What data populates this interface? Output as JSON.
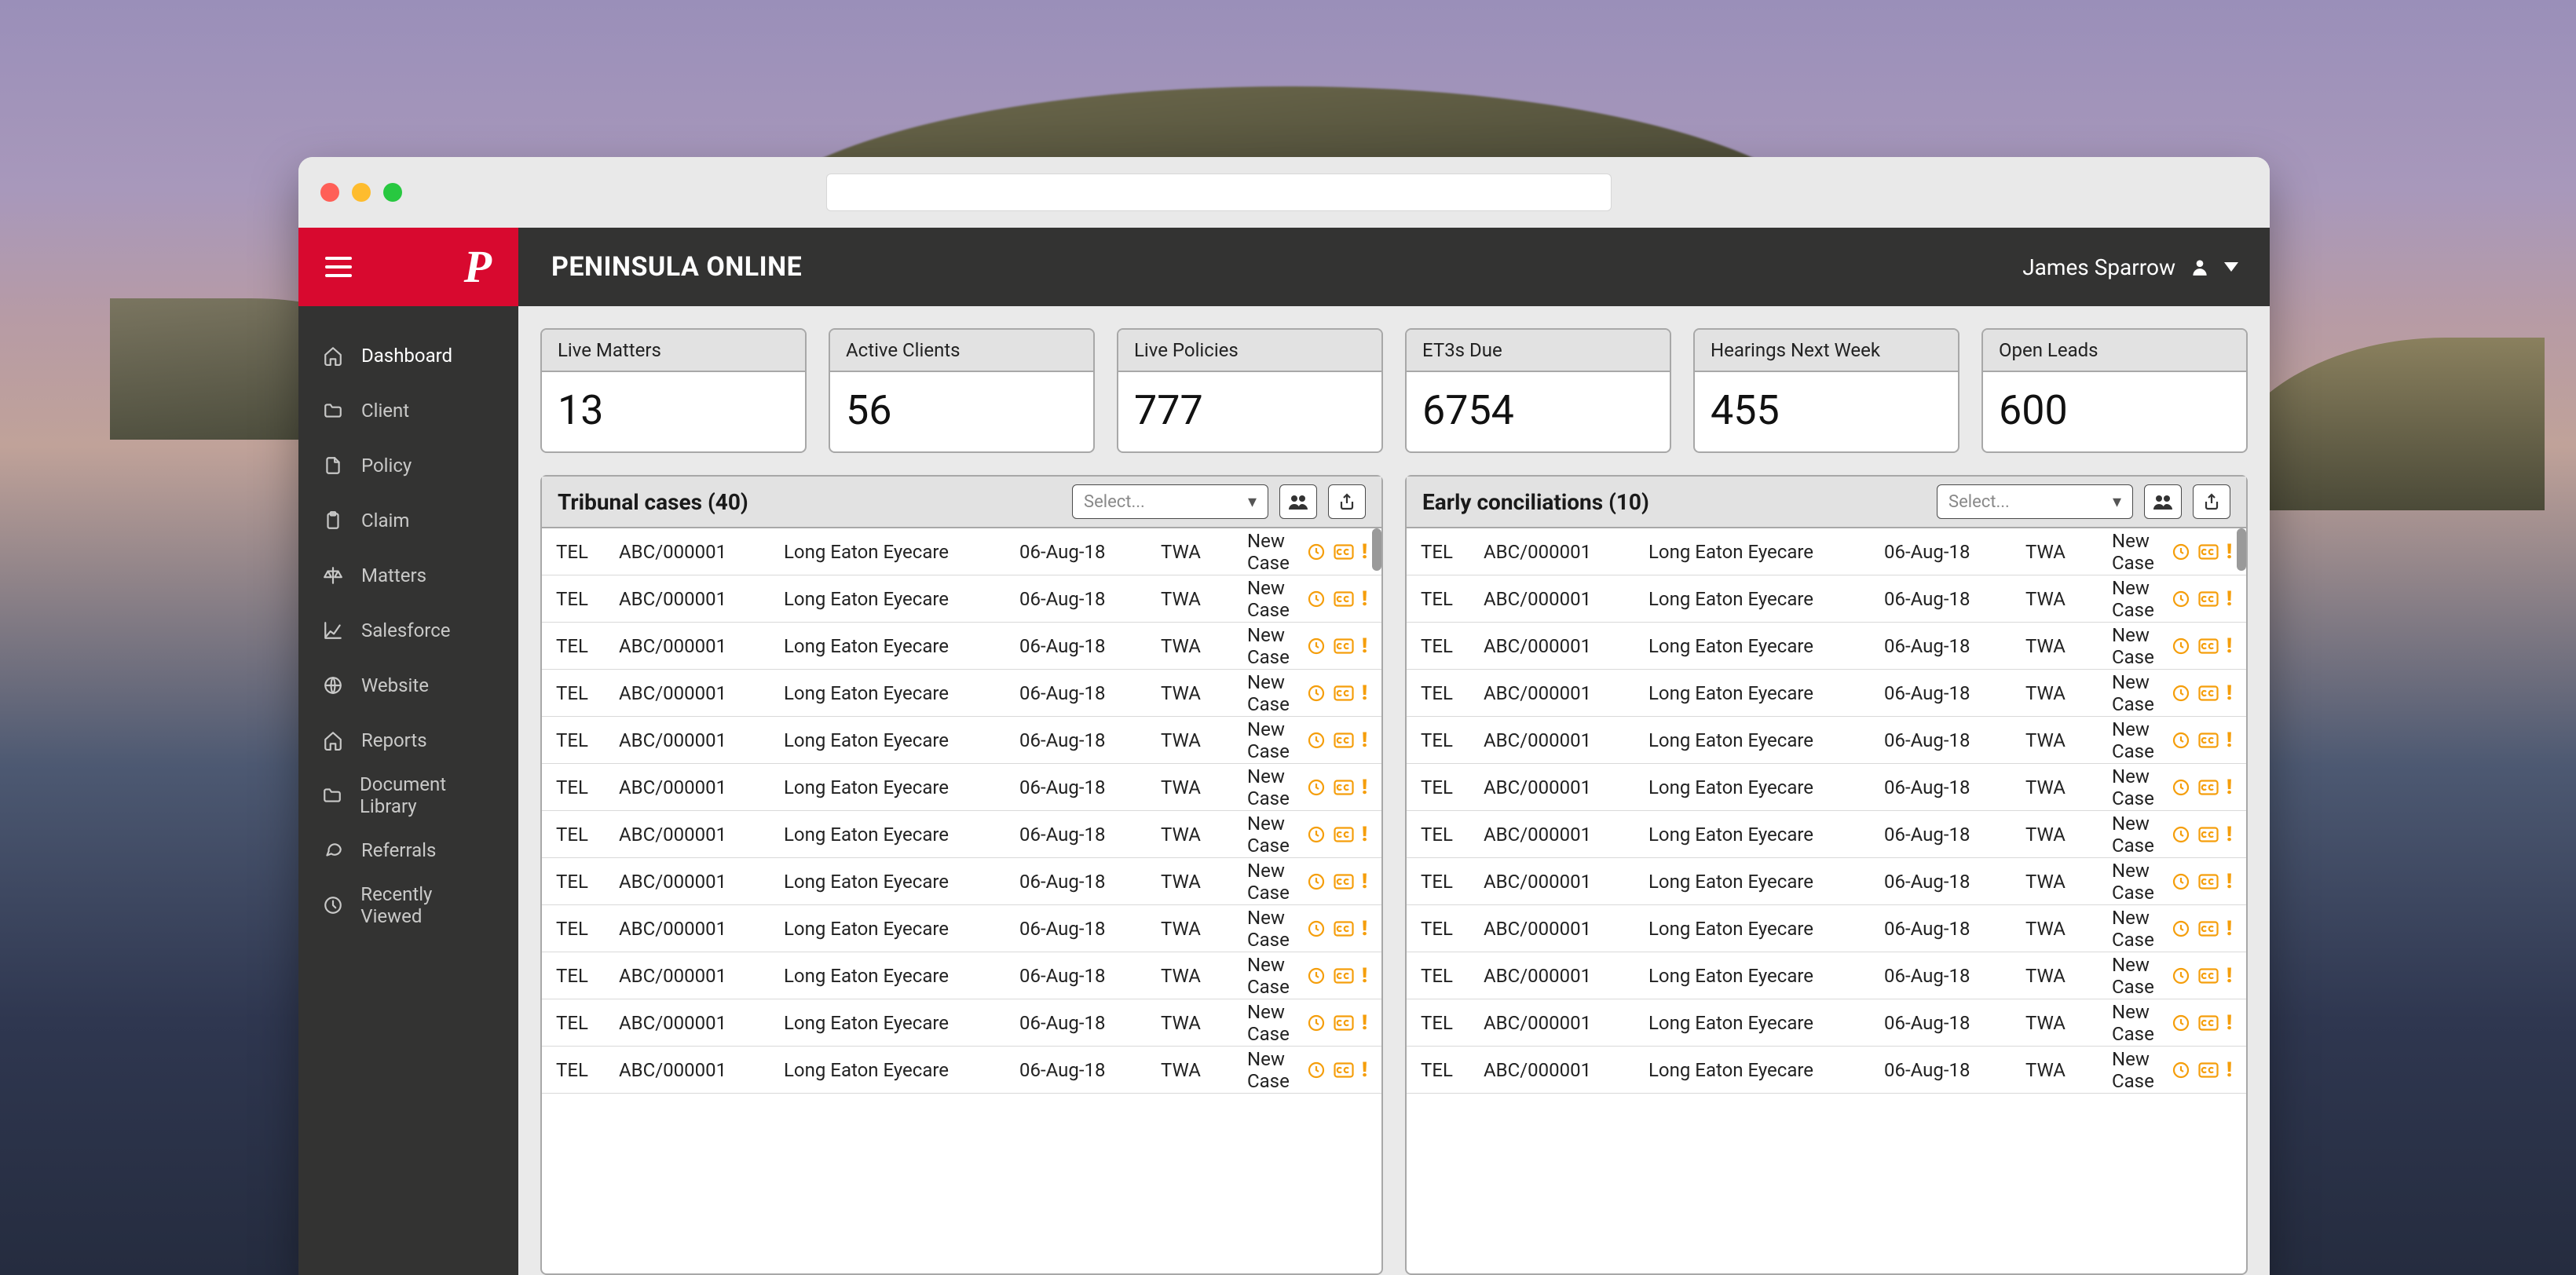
{
  "header": {
    "app_title": "PENINSULA ONLINE",
    "user_name": "James Sparrow"
  },
  "sidebar": {
    "items": [
      {
        "label": "Dashboard",
        "icon": "home"
      },
      {
        "label": "Client",
        "icon": "folder"
      },
      {
        "label": "Policy",
        "icon": "file"
      },
      {
        "label": "Claim",
        "icon": "clipboard"
      },
      {
        "label": "Matters",
        "icon": "scale"
      },
      {
        "label": "Salesforce",
        "icon": "chart"
      },
      {
        "label": "Website",
        "icon": "globe"
      },
      {
        "label": "Reports",
        "icon": "home"
      },
      {
        "label": "Document Library",
        "icon": "folder"
      },
      {
        "label": "Referrals",
        "icon": "chat"
      },
      {
        "label": "Recently Viewed",
        "icon": "clock"
      }
    ]
  },
  "stats": [
    {
      "label": "Live Matters",
      "value": "13"
    },
    {
      "label": "Active Clients",
      "value": "56"
    },
    {
      "label": "Live Policies",
      "value": "777"
    },
    {
      "label": "ET3s Due",
      "value": "6754"
    },
    {
      "label": "Hearings Next Week",
      "value": "455"
    },
    {
      "label": "Open Leads",
      "value": "600"
    }
  ],
  "panels": [
    {
      "title": "Tribunal cases (40)",
      "select_placeholder": "Select...",
      "rows": [
        {
          "type": "TEL",
          "ref": "ABC/000001",
          "client": "Long Eaton Eyecare",
          "date": "06-Aug-18",
          "owner": "TWA",
          "status": "New Case"
        },
        {
          "type": "TEL",
          "ref": "ABC/000001",
          "client": "Long Eaton Eyecare",
          "date": "06-Aug-18",
          "owner": "TWA",
          "status": "New Case"
        },
        {
          "type": "TEL",
          "ref": "ABC/000001",
          "client": "Long Eaton Eyecare",
          "date": "06-Aug-18",
          "owner": "TWA",
          "status": "New Case"
        },
        {
          "type": "TEL",
          "ref": "ABC/000001",
          "client": "Long Eaton Eyecare",
          "date": "06-Aug-18",
          "owner": "TWA",
          "status": "New Case"
        },
        {
          "type": "TEL",
          "ref": "ABC/000001",
          "client": "Long Eaton Eyecare",
          "date": "06-Aug-18",
          "owner": "TWA",
          "status": "New Case"
        },
        {
          "type": "TEL",
          "ref": "ABC/000001",
          "client": "Long Eaton Eyecare",
          "date": "06-Aug-18",
          "owner": "TWA",
          "status": "New Case"
        },
        {
          "type": "TEL",
          "ref": "ABC/000001",
          "client": "Long Eaton Eyecare",
          "date": "06-Aug-18",
          "owner": "TWA",
          "status": "New Case"
        },
        {
          "type": "TEL",
          "ref": "ABC/000001",
          "client": "Long Eaton Eyecare",
          "date": "06-Aug-18",
          "owner": "TWA",
          "status": "New Case"
        },
        {
          "type": "TEL",
          "ref": "ABC/000001",
          "client": "Long Eaton Eyecare",
          "date": "06-Aug-18",
          "owner": "TWA",
          "status": "New Case"
        },
        {
          "type": "TEL",
          "ref": "ABC/000001",
          "client": "Long Eaton Eyecare",
          "date": "06-Aug-18",
          "owner": "TWA",
          "status": "New Case"
        },
        {
          "type": "TEL",
          "ref": "ABC/000001",
          "client": "Long Eaton Eyecare",
          "date": "06-Aug-18",
          "owner": "TWA",
          "status": "New Case"
        },
        {
          "type": "TEL",
          "ref": "ABC/000001",
          "client": "Long Eaton Eyecare",
          "date": "06-Aug-18",
          "owner": "TWA",
          "status": "New Case"
        }
      ]
    },
    {
      "title": "Early conciliations (10)",
      "select_placeholder": "Select...",
      "rows": [
        {
          "type": "TEL",
          "ref": "ABC/000001",
          "client": "Long Eaton Eyecare",
          "date": "06-Aug-18",
          "owner": "TWA",
          "status": "New Case"
        },
        {
          "type": "TEL",
          "ref": "ABC/000001",
          "client": "Long Eaton Eyecare",
          "date": "06-Aug-18",
          "owner": "TWA",
          "status": "New Case"
        },
        {
          "type": "TEL",
          "ref": "ABC/000001",
          "client": "Long Eaton Eyecare",
          "date": "06-Aug-18",
          "owner": "TWA",
          "status": "New Case"
        },
        {
          "type": "TEL",
          "ref": "ABC/000001",
          "client": "Long Eaton Eyecare",
          "date": "06-Aug-18",
          "owner": "TWA",
          "status": "New Case"
        },
        {
          "type": "TEL",
          "ref": "ABC/000001",
          "client": "Long Eaton Eyecare",
          "date": "06-Aug-18",
          "owner": "TWA",
          "status": "New Case"
        },
        {
          "type": "TEL",
          "ref": "ABC/000001",
          "client": "Long Eaton Eyecare",
          "date": "06-Aug-18",
          "owner": "TWA",
          "status": "New Case"
        },
        {
          "type": "TEL",
          "ref": "ABC/000001",
          "client": "Long Eaton Eyecare",
          "date": "06-Aug-18",
          "owner": "TWA",
          "status": "New Case"
        },
        {
          "type": "TEL",
          "ref": "ABC/000001",
          "client": "Long Eaton Eyecare",
          "date": "06-Aug-18",
          "owner": "TWA",
          "status": "New Case"
        },
        {
          "type": "TEL",
          "ref": "ABC/000001",
          "client": "Long Eaton Eyecare",
          "date": "06-Aug-18",
          "owner": "TWA",
          "status": "New Case"
        },
        {
          "type": "TEL",
          "ref": "ABC/000001",
          "client": "Long Eaton Eyecare",
          "date": "06-Aug-18",
          "owner": "TWA",
          "status": "New Case"
        },
        {
          "type": "TEL",
          "ref": "ABC/000001",
          "client": "Long Eaton Eyecare",
          "date": "06-Aug-18",
          "owner": "TWA",
          "status": "New Case"
        },
        {
          "type": "TEL",
          "ref": "ABC/000001",
          "client": "Long Eaton Eyecare",
          "date": "06-Aug-18",
          "owner": "TWA",
          "status": "New Case"
        }
      ]
    }
  ]
}
